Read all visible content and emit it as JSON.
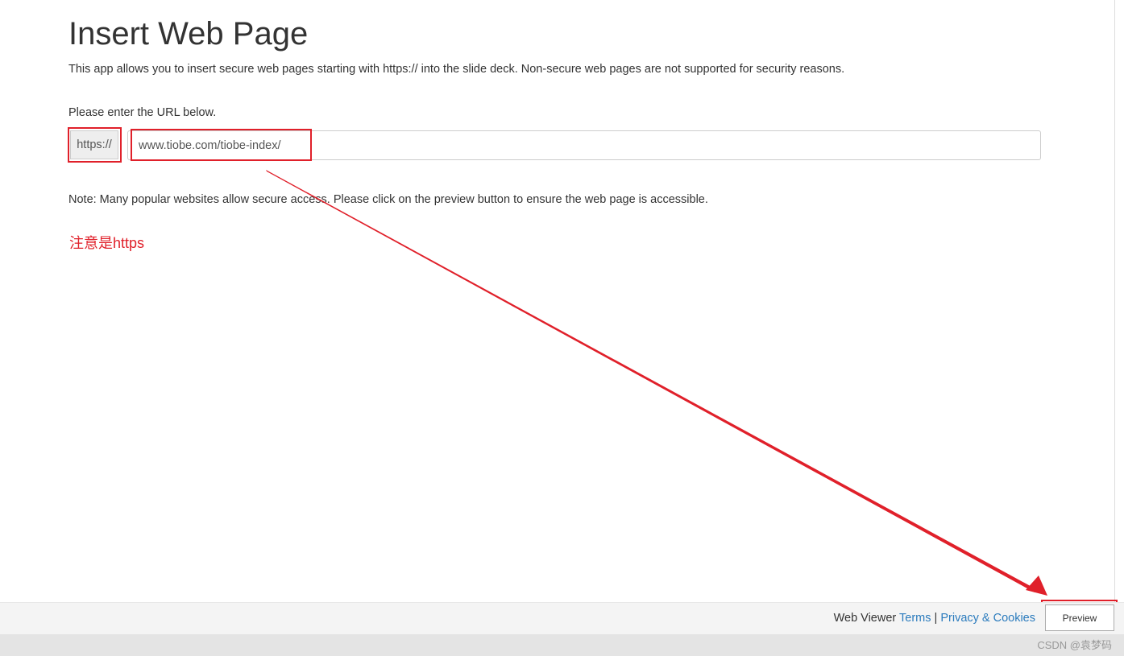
{
  "page": {
    "title": "Insert Web Page",
    "description": "This app allows you to insert secure web pages starting with https:// into the slide deck. Non-secure web pages are not supported for security reasons.",
    "url_label": "Please enter the URL below.",
    "url_prefix": "https://",
    "url_value": "www.tiobe.com/tiobe-index/",
    "note": "Note: Many popular websites allow secure access. Please click on the preview button to ensure the web page is accessible."
  },
  "annotation": {
    "text": "注意是https",
    "color": "#e0202a"
  },
  "footer": {
    "product": "Web Viewer",
    "terms": "Terms",
    "separator": "|",
    "privacy": "Privacy & Cookies",
    "preview_button": "Preview",
    "link_color": "#2b7bbd"
  },
  "watermark": "CSDN @袁梦码"
}
